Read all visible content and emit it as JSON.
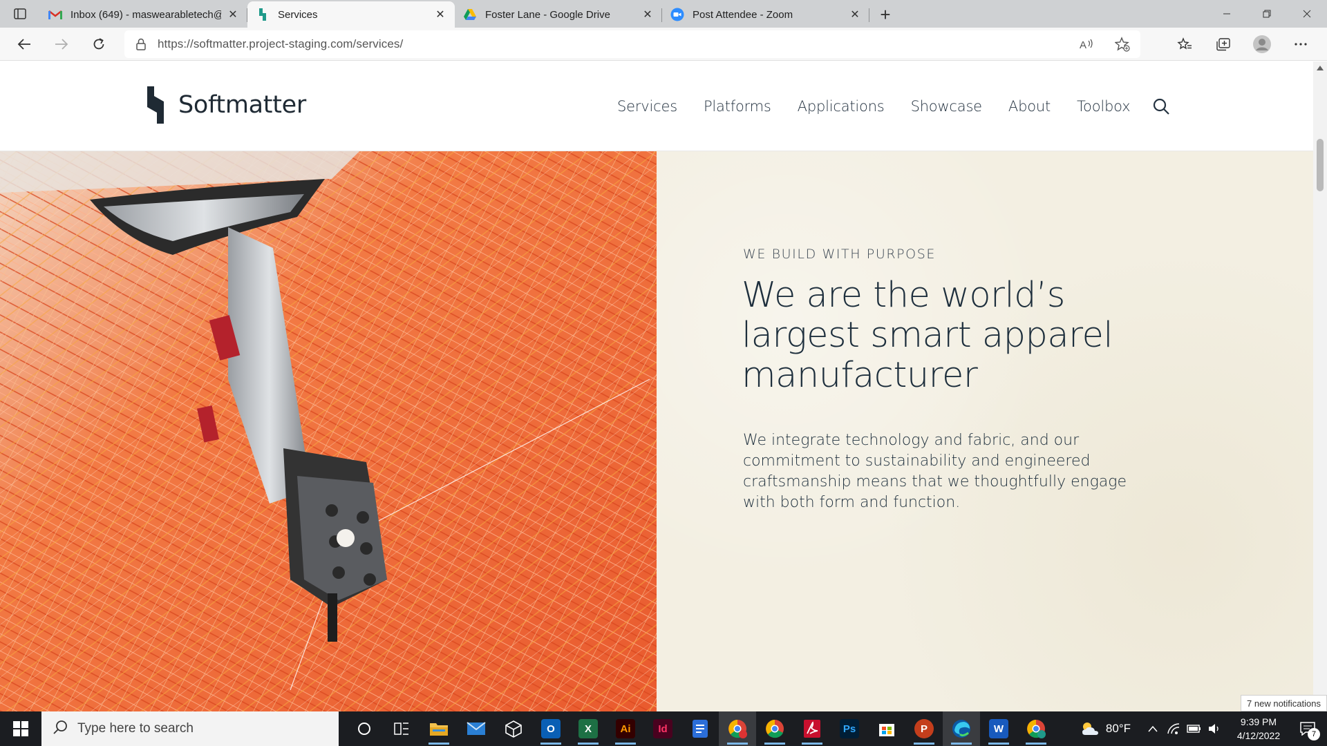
{
  "browser": {
    "tabs": [
      {
        "title": "Inbox (649) - maswearabletech@",
        "favicon": "gmail-icon",
        "active": false
      },
      {
        "title": "Services",
        "favicon": "softmatter-icon",
        "active": true
      },
      {
        "title": "Foster Lane - Google Drive",
        "favicon": "google-drive-icon",
        "active": false
      },
      {
        "title": "Post Attendee - Zoom",
        "favicon": "zoom-icon",
        "active": false
      }
    ],
    "new_tab_label": "+",
    "url": "https://softmatter.project-staging.com/services/"
  },
  "site": {
    "logo_text": "Softmatter",
    "nav": [
      "Services",
      "Platforms",
      "Applications",
      "Showcase",
      "About",
      "Toolbox"
    ],
    "hero": {
      "eyebrow": "WE BUILD WITH PURPOSE",
      "headline": "We are the world’s largest smart apparel manufacturer",
      "body": "We integrate technology and fabric, and our commitment to sustainability and engineered craftsmanship means that we thoughtfully engage with both form and function."
    }
  },
  "notification_toast": "7 new notifications",
  "taskbar": {
    "search_placeholder": "Type here to search",
    "apps": [
      {
        "name": "cortana-icon",
        "label": ""
      },
      {
        "name": "task-view-icon",
        "label": ""
      },
      {
        "name": "file-explorer-icon",
        "label": ""
      },
      {
        "name": "mail-icon",
        "label": ""
      },
      {
        "name": "3d-viewer-icon",
        "label": ""
      },
      {
        "name": "outlook-icon",
        "label": "O"
      },
      {
        "name": "excel-icon",
        "label": "X"
      },
      {
        "name": "illustrator-icon",
        "label": "Ai"
      },
      {
        "name": "indesign-icon",
        "label": "Id"
      },
      {
        "name": "docs-icon",
        "label": ""
      },
      {
        "name": "chrome-profile-icon",
        "label": ""
      },
      {
        "name": "chrome-work-icon",
        "label": ""
      },
      {
        "name": "acrobat-icon",
        "label": ""
      },
      {
        "name": "photoshop-icon",
        "label": "Ps"
      },
      {
        "name": "store-icon",
        "label": ""
      },
      {
        "name": "powerpoint-icon",
        "label": "P"
      },
      {
        "name": "edge-icon",
        "label": ""
      },
      {
        "name": "word-icon",
        "label": "W"
      },
      {
        "name": "chrome-s-icon",
        "label": ""
      }
    ],
    "weather": "80°F",
    "time": "9:39 PM",
    "date": "4/12/2022",
    "notification_count": "7"
  },
  "colors": {
    "tabstrip": "#cfd1d3",
    "hero_bg": "#f3efe2",
    "headline": "#1e2f3d",
    "taskbar": "#1b1d21",
    "thread_orange": "#ee6a3c"
  }
}
